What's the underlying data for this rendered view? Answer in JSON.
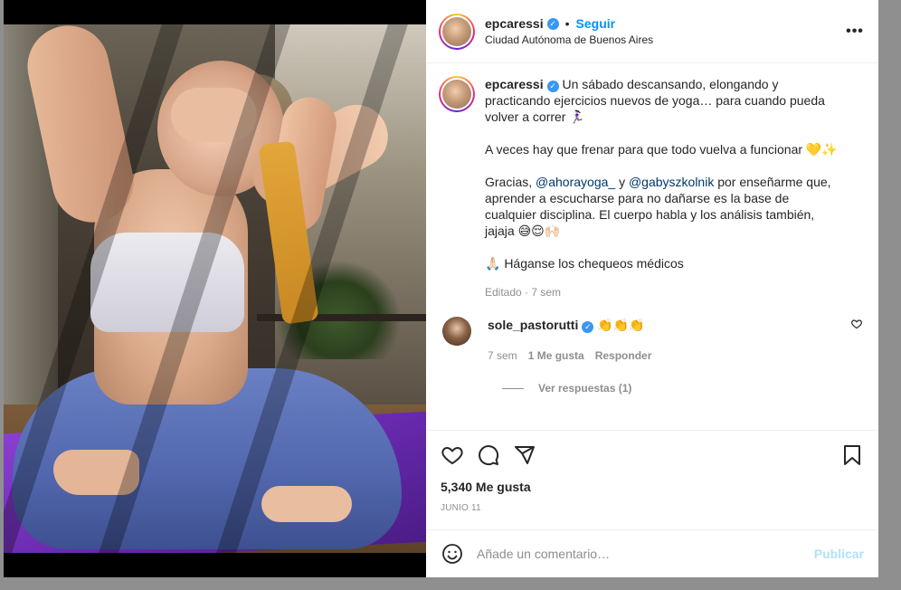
{
  "post": {
    "username": "epcaressi",
    "follow_label": "Seguir",
    "dot": "•",
    "location": "Ciudad Autónoma de Buenos Aires",
    "more": "•••"
  },
  "caption": {
    "username": "epcaressi",
    "line1": " Un sábado descansando, elongando y practicando ejercicios nuevos de yoga… para cuando pueda volver a correr 🏃🏻‍♀️",
    "line2": "A veces hay que frenar para que todo vuelva a funcionar 💛✨",
    "line3a": "Gracias, ",
    "mention1": "@ahorayoga_",
    "line3b": " y ",
    "mention2": "@gabyszkolnik",
    "line3c": " por enseñarme que, aprender a escucharse para no dañarse es la base de cualquier disciplina. El cuerpo habla y los análisis también, jajaja 😅😌🙌🏻",
    "line4": "🙏🏻 Háganse los chequeos médicos",
    "meta": "Editado · 7 sem"
  },
  "comment": {
    "username": "sole_pastorutti",
    "text": " 👏👏👏",
    "time": "7 sem",
    "likes": "1 Me gusta",
    "reply": "Responder",
    "view_replies": "Ver respuestas (1)"
  },
  "footer": {
    "likes": "5,340 Me gusta",
    "date": "JUNIO 11",
    "comment_placeholder": "Añade un comentario…",
    "publish": "Publicar"
  },
  "colors": {
    "link": "#0095f6",
    "verified": "#3897f0",
    "publish_disabled": "#b2dffc"
  }
}
